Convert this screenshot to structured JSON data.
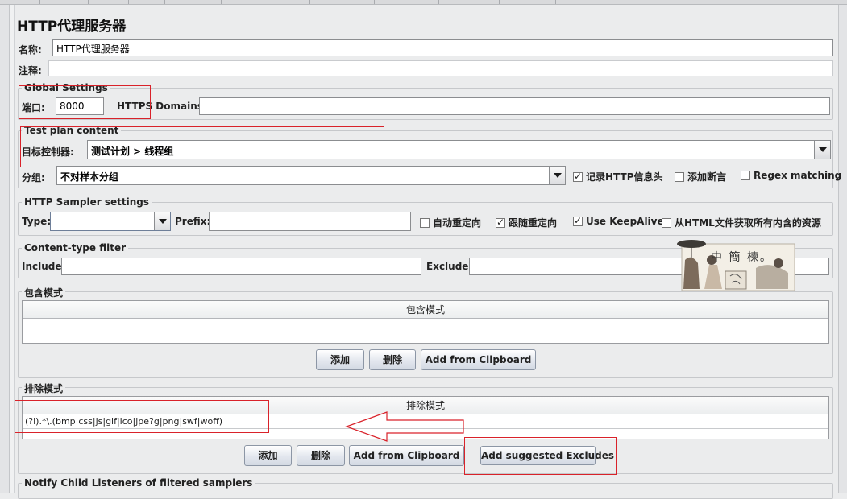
{
  "title": "HTTP代理服务器",
  "name_label": "名称:",
  "name_value": "HTTP代理服务器",
  "comment_label": "注释:",
  "comment_value": "",
  "global": {
    "legend": "Global Settings",
    "port_label": "端口:",
    "port_value": "8000",
    "https_label": "HTTPS Domains :",
    "https_value": ""
  },
  "testplan": {
    "legend": "Test plan content",
    "target_label": "目标控制器:",
    "target_value": "测试计划 > 线程组",
    "group_label": "分组:",
    "group_value": "不对样本分组",
    "record_headers": {
      "label": "记录HTTP信息头",
      "checked": true
    },
    "add_assertions": {
      "label": "添加断言",
      "checked": false
    },
    "regex_matching": {
      "label": "Regex matching",
      "checked": false
    }
  },
  "sampler": {
    "legend": "HTTP Sampler settings",
    "type_label": "Type:",
    "type_value": "",
    "prefix_label": "Prefix:",
    "prefix_value": "",
    "auto_redirect": {
      "label": "自动重定向",
      "checked": false
    },
    "follow_redirect": {
      "label": "跟随重定向",
      "checked": true
    },
    "keepalive": {
      "label": "Use KeepAlive",
      "checked": true
    },
    "retrieve_resources": {
      "label": "从HTML文件获取所有内含的资源",
      "checked": false
    }
  },
  "content_filter": {
    "legend": "Content-type filter",
    "include_label": "Include:",
    "include_value": "",
    "exclude_label": "Exclude:",
    "exclude_value": ""
  },
  "include_patterns": {
    "legend": "包含模式",
    "column": "包含模式",
    "rows": [],
    "add": "添加",
    "delete": "删除",
    "clipboard": "Add from Clipboard"
  },
  "exclude_patterns": {
    "legend": "排除模式",
    "column": "排除模式",
    "rows": [
      "(?i).*\\.(bmp|css|js|gif|ico|jpe?g|png|swf|woff)"
    ],
    "add": "添加",
    "delete": "删除",
    "clipboard": "Add from Clipboard",
    "suggested": "Add suggested Excludes"
  },
  "notify": {
    "legend": "Notify Child Listeners of filtered samplers"
  },
  "watermark_text": "中 簡 楝。",
  "colors": {
    "annotation_red": "#d9222a",
    "panel_bg": "#ebeced"
  }
}
